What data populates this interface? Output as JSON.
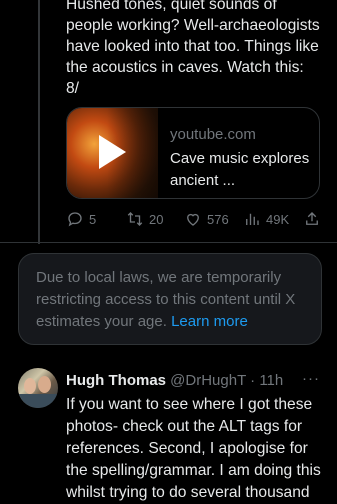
{
  "tweet": {
    "text": "Hushed tones, quiet sounds of\npeople working? Well-archaeologists\nhave looked into that too. Things like\nthe acoustics in caves. Watch this:\n8/"
  },
  "card": {
    "domain": "youtube.com",
    "title": "Cave music explores ancient ..."
  },
  "actions": {
    "replies": "5",
    "retweets": "20",
    "likes": "576",
    "views": "49K"
  },
  "notice": {
    "text": "Due to local laws, we are temporarily restricting access to this content until X estimates your age. ",
    "link": "Learn more"
  },
  "reply": {
    "name": "Hugh Thomas",
    "handle": "@DrHughT",
    "time": "11h",
    "separator": " · ",
    "more": "···",
    "text": "If you want to see where I got these photos- check out the ALT tags for references. Second, I apologise for the spelling/grammar. I am doing this whilst trying to do several thousand"
  },
  "colors": {
    "background": "#000000",
    "text": "#e7e9ea",
    "muted": "#71767b",
    "link": "#1d9bf0",
    "border": "#2f3336"
  }
}
